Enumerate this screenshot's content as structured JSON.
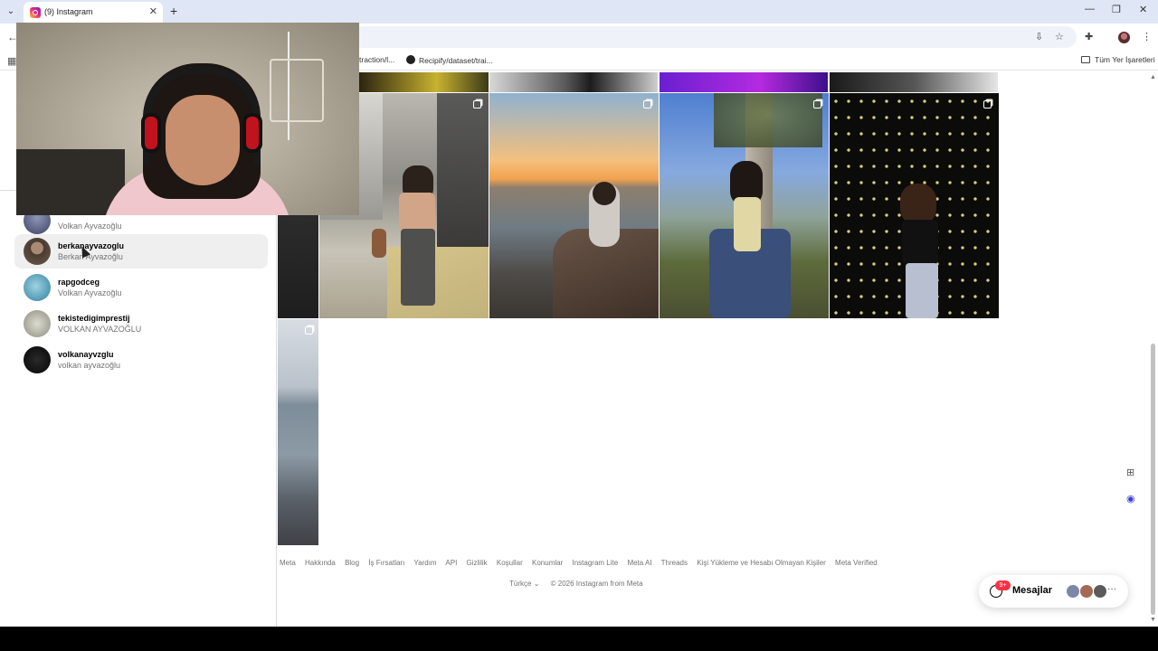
{
  "browser": {
    "tab_title": "(9) Instagram",
    "bookmarks": [
      "traction/l...",
      "Recipify/dataset/trai..."
    ],
    "bookmarks_folder": "Tüm Yer İşaretleri"
  },
  "accounts": [
    {
      "username": "",
      "name": "Volkan Ayvazoğlu"
    },
    {
      "username": "berkanayvazoglu",
      "name": "Berkan Ayvazoğlu"
    },
    {
      "username": "rapgodceg",
      "name": "Volkan Ayvazoğlu"
    },
    {
      "username": "tekistedigimprestij",
      "name": "VOLKAN AYVAZOĞLU"
    },
    {
      "username": "volkanayvzglu",
      "name": "volkan ayvazoğlu"
    }
  ],
  "footer": {
    "links": [
      "Meta",
      "Hakkında",
      "Blog",
      "İş Fırsatları",
      "Yardım",
      "API",
      "Gizlilik",
      "Koşullar",
      "Konumlar",
      "Instagram Lite",
      "Meta AI",
      "Threads",
      "Kişi Yükleme ve Hesabı Olmayan Kişiler",
      "Meta Verified"
    ],
    "language": "Türkçe",
    "copyright": "© 2026 Instagram from Meta"
  },
  "messages": {
    "label": "Mesajlar",
    "badge": "9+"
  }
}
